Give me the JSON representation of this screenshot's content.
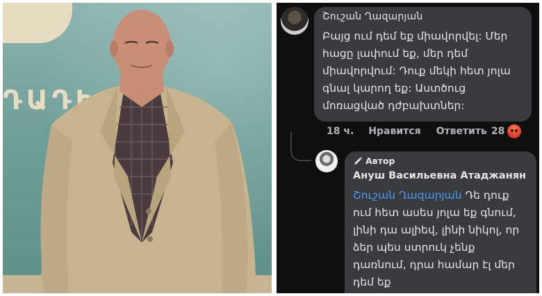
{
  "photo": {
    "wall_letters": "ԴԱԴԻ",
    "description_icon": "person-photo"
  },
  "comment1": {
    "author": "Շուշան Ղազարյան",
    "text": "Բայց ում դեմ եք միավորվել: Մեր հացը լափում եք, մեր դեմ միավորվում: Դուք մեկի հետ յոլա գնալ կարող եք: Աստծուց մոռացված դժբախտներ:",
    "time": "18 ч.",
    "like_label": "Нравится",
    "reply_label": "Ответить",
    "reaction_count": "28",
    "reaction_icon": "angry-icon"
  },
  "comment2": {
    "badge_label": "Автор",
    "author": "Ануш Васильевна Атаджанян",
    "mention": "Շուշան Ղազարյան",
    "text": " Դե դուք ում հետ ասես յոլա եք գնում, լինի դա ալիեվ, լինի նիկոլ, որ ձեր պես ստրուկ չենք դառնում, դրա համար էլ մեր դեմ եք"
  },
  "colors": {
    "chat_bg": "#0f0f10",
    "bubble": "#3a3b3c",
    "mention": "#4599ff",
    "meta": "#b0b3b8"
  }
}
